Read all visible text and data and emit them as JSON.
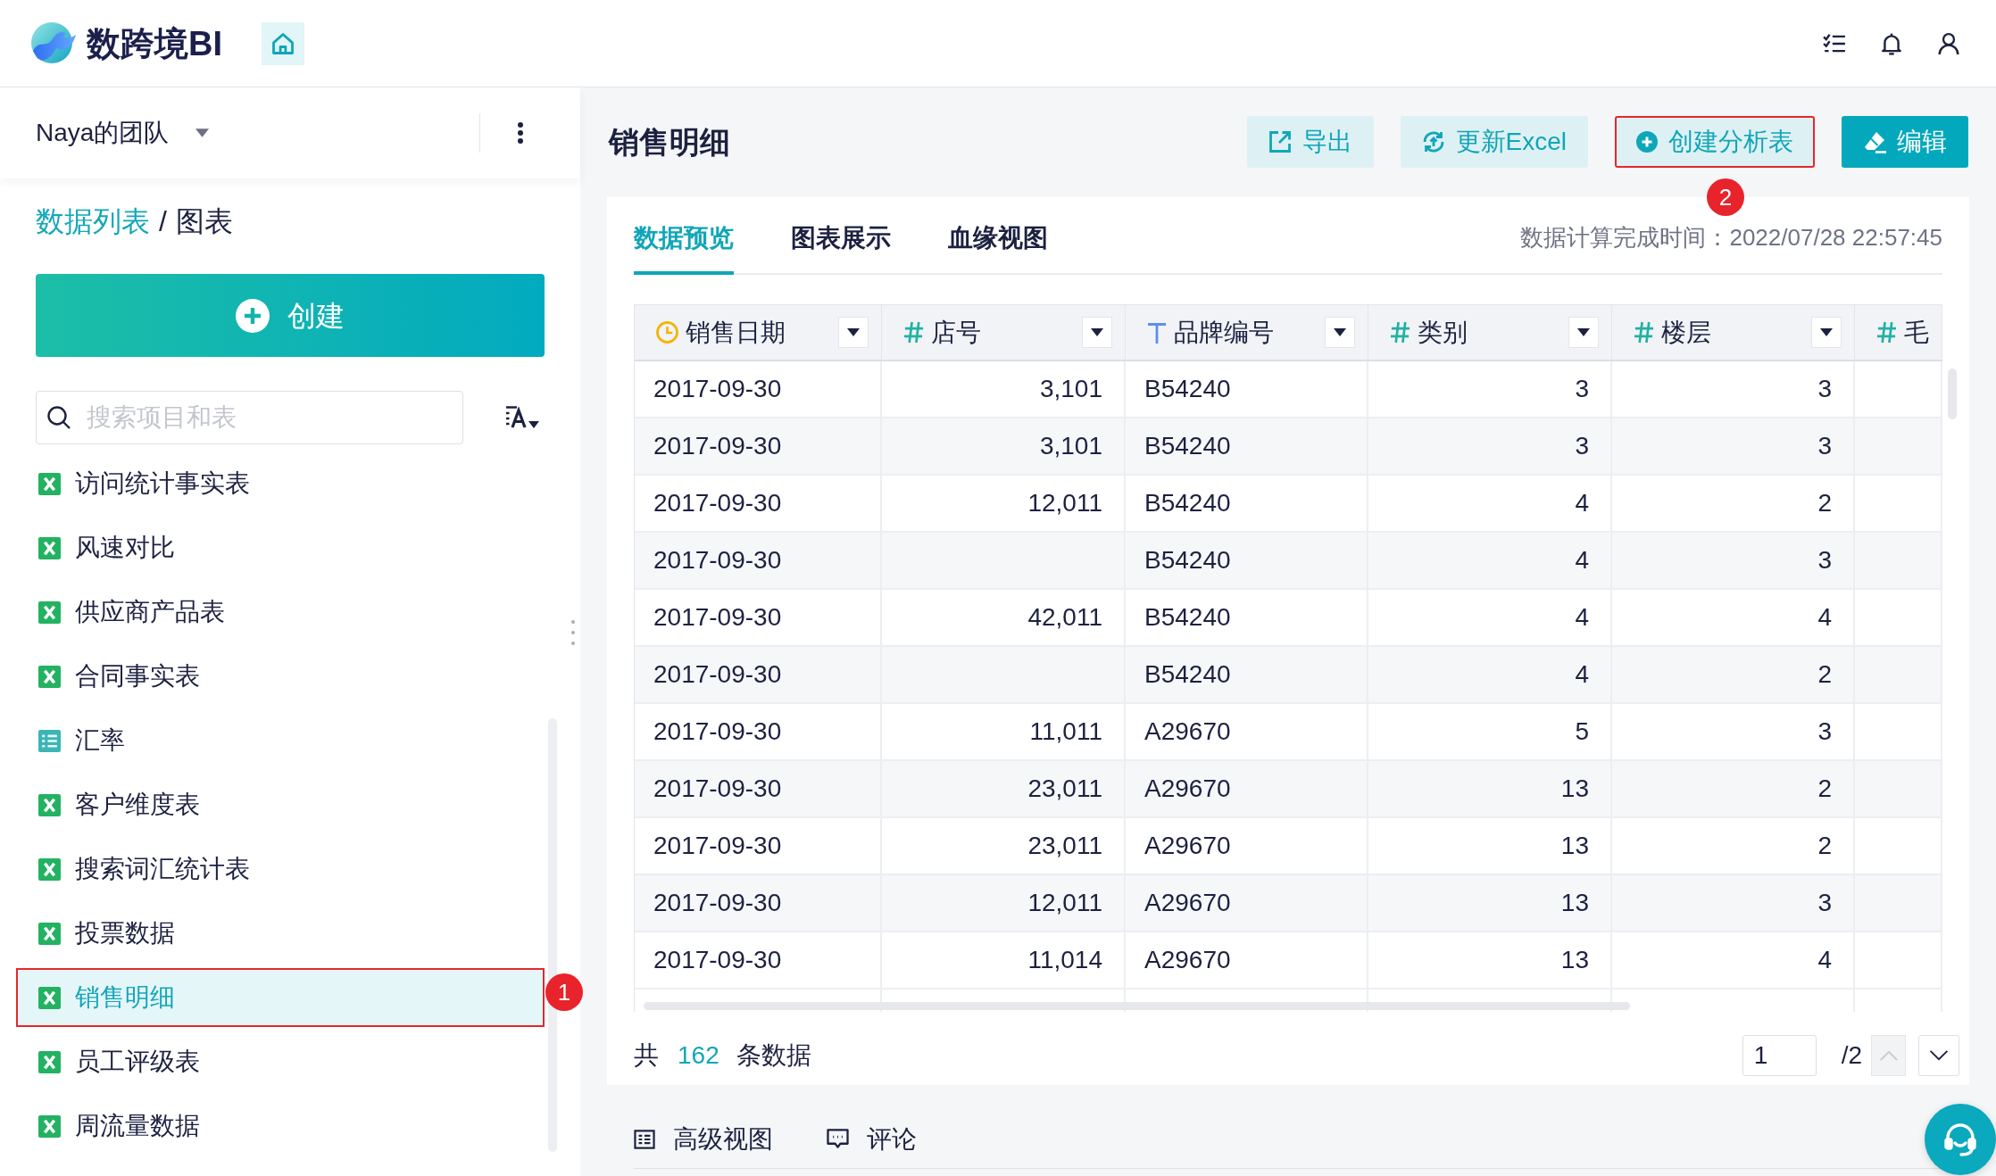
{
  "header": {
    "logo_text": "数跨境BI"
  },
  "sidebar": {
    "team": "Naya的团队",
    "breadcrumb": {
      "items": [
        "数据列表",
        "图表"
      ],
      "separator": "/"
    },
    "create_button": "创建",
    "search": {
      "placeholder": "搜索项目和表"
    },
    "items": [
      {
        "label": "访问统计事实表",
        "kind": "excel",
        "selected": false
      },
      {
        "label": "风速对比",
        "kind": "excel",
        "selected": false
      },
      {
        "label": "供应商产品表",
        "kind": "excel",
        "selected": false
      },
      {
        "label": "合同事实表",
        "kind": "excel",
        "selected": false
      },
      {
        "label": "汇率",
        "kind": "table",
        "selected": false
      },
      {
        "label": "客户维度表",
        "kind": "excel",
        "selected": false
      },
      {
        "label": "搜索词汇统计表",
        "kind": "excel",
        "selected": false
      },
      {
        "label": "投票数据",
        "kind": "excel",
        "selected": false
      },
      {
        "label": "销售明细",
        "kind": "excel",
        "selected": true,
        "callout": "1"
      },
      {
        "label": "员工评级表",
        "kind": "excel",
        "selected": false
      },
      {
        "label": "周流量数据",
        "kind": "excel",
        "selected": false
      }
    ]
  },
  "main": {
    "title": "销售明细",
    "actions": [
      {
        "label": "导出",
        "kind": "export"
      },
      {
        "label": "更新Excel",
        "kind": "sync"
      },
      {
        "label": "创建分析表",
        "kind": "add",
        "callout": "2"
      },
      {
        "label": "编辑",
        "kind": "edit"
      }
    ],
    "tabs": [
      {
        "label": "数据预览",
        "selected": true
      },
      {
        "label": "图表展示",
        "selected": false
      },
      {
        "label": "血缘视图",
        "selected": false
      }
    ],
    "timestamp": "数据计算完成时间：2022/07/28 22:57:45",
    "table": {
      "columns": [
        {
          "label": "销售日期",
          "kind": "date"
        },
        {
          "label": "店号",
          "kind": "number"
        },
        {
          "label": "品牌编号",
          "kind": "text"
        },
        {
          "label": "类别",
          "kind": "number"
        },
        {
          "label": "楼层",
          "kind": "number"
        },
        {
          "label": "毛",
          "kind": "number"
        }
      ],
      "rows": [
        [
          "2017-09-30",
          "3,101",
          "B54240",
          "3",
          "3"
        ],
        [
          "2017-09-30",
          "3,101",
          "B54240",
          "3",
          "3"
        ],
        [
          "2017-09-30",
          "12,011",
          "B54240",
          "4",
          "2"
        ],
        [
          "2017-09-30",
          null,
          "B54240",
          "4",
          "3"
        ],
        [
          "2017-09-30",
          "42,011",
          "B54240",
          "4",
          "4"
        ],
        [
          "2017-09-30",
          null,
          "B54240",
          "4",
          "2"
        ],
        [
          "2017-09-30",
          "11,011",
          "A29670",
          "5",
          "3"
        ],
        [
          "2017-09-30",
          "23,011",
          "A29670",
          "13",
          "2"
        ],
        [
          "2017-09-30",
          "23,011",
          "A29670",
          "13",
          "2"
        ],
        [
          "2017-09-30",
          "12,011",
          "A29670",
          "13",
          "3"
        ],
        [
          "2017-09-30",
          "11,014",
          "A29670",
          "13",
          "4"
        ]
      ]
    },
    "footer": {
      "prefix": "共",
      "count": "162",
      "suffix": "条数据"
    },
    "pagination": {
      "page": "1",
      "total": "/2",
      "prev_disabled": true,
      "next_disabled": false
    },
    "bottom_tabs": [
      {
        "label": "高级视图",
        "kind": "layout"
      },
      {
        "label": "评论",
        "kind": "comment"
      }
    ]
  }
}
